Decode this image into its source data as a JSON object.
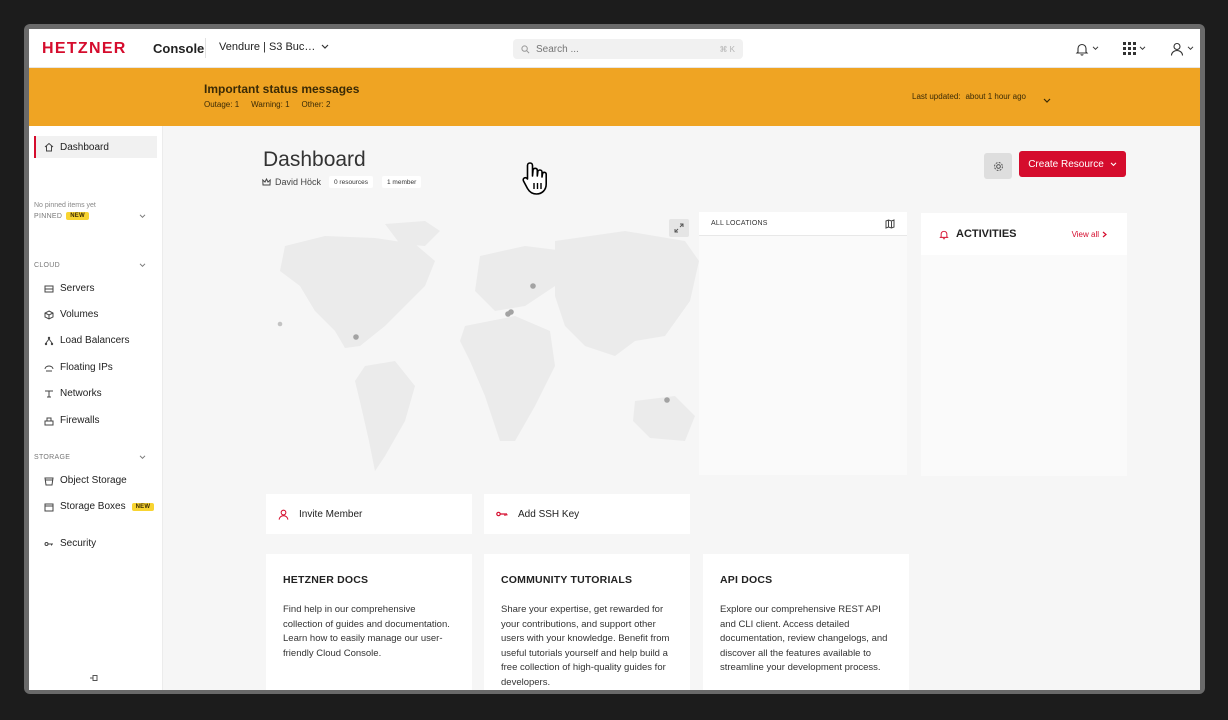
{
  "topbar": {
    "logo": "HETZNER",
    "console_label": "Console",
    "project": "Vendure | S3 Buc…",
    "search": {
      "placeholder": "Search ...",
      "shortcut": "⌘ K"
    }
  },
  "banner": {
    "title": "Important status messages",
    "outage": "Outage:  1",
    "warning": "Warning:  1",
    "other": "Other:  2",
    "last_updated_label": "Last updated:",
    "last_updated_value": "about 1 hour ago"
  },
  "sidebar": {
    "dashboard": "Dashboard",
    "pinned": {
      "heading": "PINNED",
      "badge": "NEW",
      "empty": "No pinned items yet"
    },
    "cloud": {
      "heading": "CLOUD",
      "items": [
        "Servers",
        "Volumes",
        "Load Balancers",
        "Floating IPs",
        "Networks",
        "Firewalls"
      ]
    },
    "storage": {
      "heading": "STORAGE",
      "items": [
        "Object Storage",
        "Storage Boxes"
      ],
      "storage_boxes_badge": "NEW"
    },
    "security": "Security"
  },
  "main": {
    "title": "Dashboard",
    "owner": "David Höck",
    "resources": "0 resources",
    "members": "1 member",
    "create_button": "Create Resource",
    "locations_heading": "ALL LOCATIONS",
    "activities_heading": "ACTIVITIES",
    "view_all": "View all",
    "invite_member": "Invite Member",
    "add_ssh_key": "Add SSH Key",
    "docs": [
      {
        "title": "HETZNER DOCS",
        "body": "Find help in our comprehensive collection of guides and documentation. Learn how to easily manage our user-friendly Cloud Console."
      },
      {
        "title": "COMMUNITY TUTORIALS",
        "body": "Share your expertise, get rewarded for your contributions, and support other users with your knowledge. Benefit from useful tutorials yourself and help build a free collection of high-quality guides for developers."
      },
      {
        "title": "API DOCS",
        "body": "Explore our comprehensive REST API and CLI client. Access detailed documentation, review changelogs, and discover all the features available to streamline your development process."
      }
    ]
  },
  "colors": {
    "brand": "#d50c2d",
    "banner": "#efa423",
    "badge": "#f8d431"
  },
  "icons": [
    "search-icon",
    "bell-icon",
    "apps-grid-icon",
    "user-icon",
    "home-icon",
    "server-icon",
    "volume-icon",
    "load-balancer-icon",
    "floating-ip-icon",
    "network-icon",
    "firewall-icon",
    "object-storage-icon",
    "storage-box-icon",
    "key-icon",
    "pin-icon",
    "gear-icon",
    "map-icon",
    "expand-icon",
    "hand-cursor-icon"
  ]
}
